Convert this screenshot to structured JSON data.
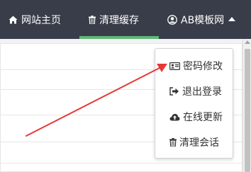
{
  "topbar": {
    "home_label": "网站主页",
    "cache_label": "清理缓存",
    "user_label": "AB模板网"
  },
  "dropdown": {
    "items": [
      {
        "label": "密码修改",
        "icon": "id-card-icon"
      },
      {
        "label": "退出登录",
        "icon": "sign-out-icon"
      },
      {
        "label": "在线更新",
        "icon": "cloud-upload-icon"
      },
      {
        "label": "清理会话",
        "icon": "trash-icon"
      }
    ]
  },
  "colors": {
    "topbar_bg": "#393d49",
    "active_underline": "#5fb878",
    "arrow": "#e53935"
  }
}
